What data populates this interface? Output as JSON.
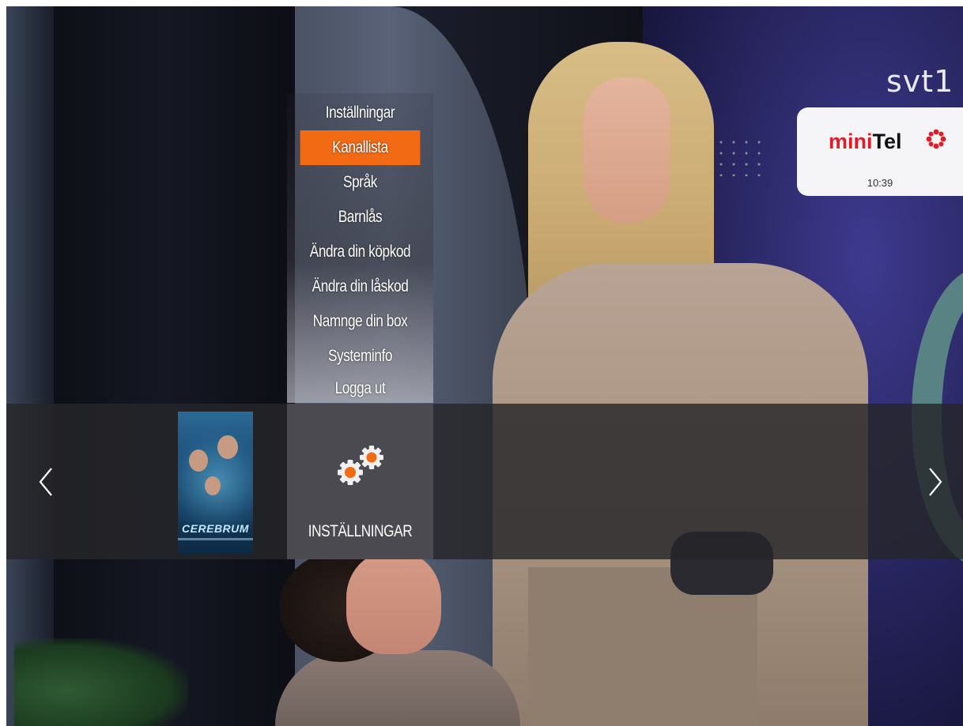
{
  "channel": {
    "logo_text": "svt1",
    "overlay_brand_prefix": "mini",
    "overlay_brand_suffix": "Tel",
    "clock": "10:39"
  },
  "menu": {
    "items": [
      {
        "label": "Inställningar",
        "selected": false
      },
      {
        "label": "Kanallista",
        "selected": true
      },
      {
        "label": "Språk",
        "selected": false
      },
      {
        "label": "Barnlås",
        "selected": false
      },
      {
        "label": "Ändra din köpkod",
        "selected": false
      },
      {
        "label": "Ändra din låskod",
        "selected": false
      },
      {
        "label": "Namnge din box",
        "selected": false
      },
      {
        "label": "Systeminfo",
        "selected": false
      },
      {
        "label": "Logga ut",
        "selected": false
      }
    ]
  },
  "carousel": {
    "tiles": [
      {
        "type": "poster",
        "title": "CEREBRUM"
      },
      {
        "type": "settings",
        "label": "INSTÄLLNINGAR",
        "icon": "gears-icon"
      }
    ],
    "prev_icon": "chevron-left-icon",
    "next_icon": "chevron-right-icon"
  },
  "colors": {
    "accent": "#f26a13",
    "menu_text": "#ffffff",
    "brand_red": "#e11b2a"
  }
}
